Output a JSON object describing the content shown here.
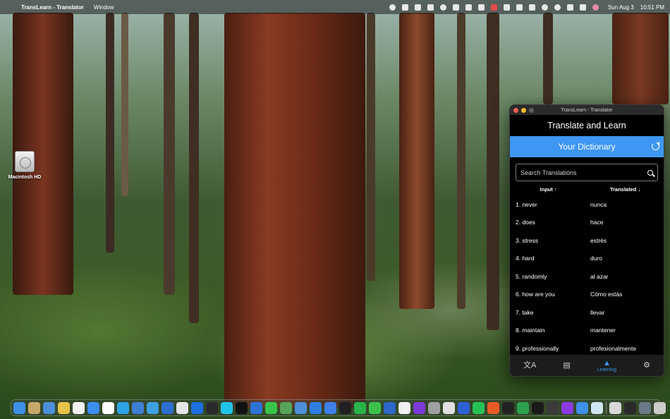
{
  "menubar": {
    "app_name": "TransLearn - Translator",
    "menus": [
      "Window"
    ],
    "date": "Sun Aug 3",
    "time": "10:51 PM"
  },
  "desktop": {
    "icons": [
      {
        "label": "Macintosh HD",
        "icon": "hard-drive-icon"
      }
    ]
  },
  "window": {
    "title": "TransLearn - Translator",
    "header": "Translate and Learn",
    "dictionary_title": "Your Dictionary",
    "search_placeholder": "Search Translations",
    "columns": {
      "input": "Input",
      "translated": "Translated"
    },
    "rows": [
      {
        "input": "1. never",
        "translated": "nunca"
      },
      {
        "input": "2. does",
        "translated": "hace"
      },
      {
        "input": "3. stress",
        "translated": "estrés"
      },
      {
        "input": "4. hard",
        "translated": "duro"
      },
      {
        "input": "5. randomly",
        "translated": "al azar"
      },
      {
        "input": "6. how are you",
        "translated": "Cómo estás"
      },
      {
        "input": "7. take",
        "translated": "llevar"
      },
      {
        "input": "8. maintain",
        "translated": "mantener"
      },
      {
        "input": "9. professionally",
        "translated": "profesionalmente"
      }
    ],
    "tabs": [
      {
        "icon": "translate-icon",
        "label": ""
      },
      {
        "icon": "book-icon",
        "label": ""
      },
      {
        "icon": "graduation-cap-icon",
        "label": "Learning"
      },
      {
        "icon": "gear-icon",
        "label": ""
      }
    ],
    "accent_color": "#3e97f2"
  },
  "dock": {
    "apps": [
      "#3d8fe8",
      "#c8a86a",
      "#4a8fd8",
      "#e8c24a",
      "#f2f2f2",
      "#3b8df0",
      "#ffffff",
      "#2ea3e6",
      "#3e7fd6",
      "#3da0e0",
      "#2d6fd1",
      "#e5e5e5",
      "#1d6fe0",
      "#2a2a2a",
      "#22c3e8",
      "#111111",
      "#2d73d8",
      "#38c44a",
      "#5aa35a",
      "#4c8fd8",
      "#2f7fe0",
      "#3f7fe8",
      "#202020",
      "#29b34a",
      "#3dc04a",
      "#2d67c8",
      "#f0f0f0",
      "#7c3ad8",
      "#a0a0a0",
      "#e0e0e0",
      "#2d5fd6",
      "#27c255",
      "#e65a28",
      "#222222",
      "#2ba04f",
      "#1a1a1a",
      "#3a3a3a",
      "#8a3ae0",
      "#3d8fe8",
      "#cfe6f0",
      "#d8d8d8",
      "#2a2a2a",
      "#6a7a86",
      "#cccccc"
    ]
  }
}
